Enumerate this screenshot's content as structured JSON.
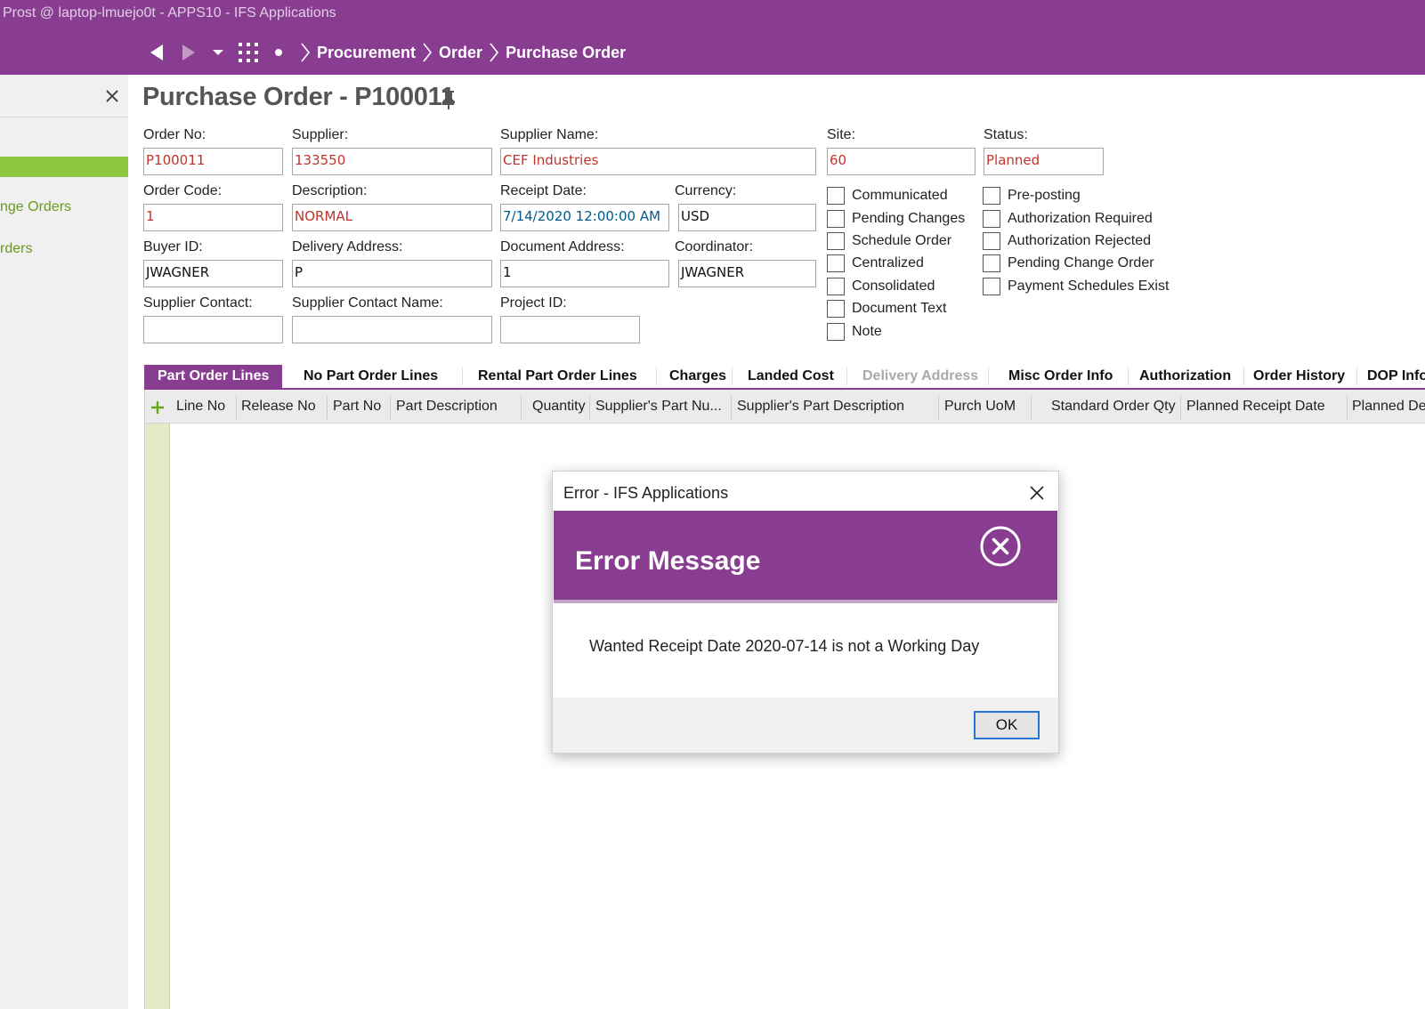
{
  "window": {
    "title": "Prost @ laptop-lmuejo0t - APPS10 - IFS Applications"
  },
  "breadcrumb": [
    "Procurement",
    "Order",
    "Purchase Order"
  ],
  "sidebar": {
    "links": [
      "nge Orders",
      "rders"
    ]
  },
  "page": {
    "title": "Purchase Order - P100011"
  },
  "form": {
    "order_no": {
      "label": "Order No:",
      "value": "P100011"
    },
    "supplier": {
      "label": "Supplier:",
      "value": "133550"
    },
    "supplier_name": {
      "label": "Supplier Name:",
      "value": "CEF Industries"
    },
    "site": {
      "label": "Site:",
      "value": "60"
    },
    "status": {
      "label": "Status:",
      "value": "Planned"
    },
    "order_code": {
      "label": "Order Code:",
      "value": "1"
    },
    "description": {
      "label": "Description:",
      "value": "NORMAL"
    },
    "receipt_date": {
      "label": "Receipt Date:",
      "value": "7/14/2020 12:00:00 AM"
    },
    "currency": {
      "label": "Currency:",
      "value": "USD"
    },
    "buyer_id": {
      "label": "Buyer ID:",
      "value": "JWAGNER"
    },
    "delivery_address": {
      "label": "Delivery Address:",
      "value": "P"
    },
    "document_address": {
      "label": "Document Address:",
      "value": "1"
    },
    "coordinator": {
      "label": "Coordinator:",
      "value": "JWAGNER"
    },
    "supplier_contact": {
      "label": "Supplier Contact:",
      "value": ""
    },
    "supplier_contact_name": {
      "label": "Supplier Contact Name:",
      "value": ""
    },
    "project_id": {
      "label": "Project ID:",
      "value": ""
    }
  },
  "checkboxes_left": [
    {
      "label": "Communicated",
      "checked": false
    },
    {
      "label": "Pending Changes",
      "checked": false
    },
    {
      "label": "Schedule Order",
      "checked": false
    },
    {
      "label": "Centralized",
      "checked": false
    },
    {
      "label": "Consolidated",
      "checked": false
    },
    {
      "label": "Document Text",
      "checked": false
    },
    {
      "label": "Note",
      "checked": false
    }
  ],
  "checkboxes_right": [
    {
      "label": "Pre-posting",
      "checked": false
    },
    {
      "label": "Authorization Required",
      "checked": false
    },
    {
      "label": "Authorization Rejected",
      "checked": false
    },
    {
      "label": "Pending Change Order",
      "checked": false
    },
    {
      "label": "Payment Schedules Exist",
      "checked": false
    }
  ],
  "tabs": [
    {
      "label": "Part Order Lines",
      "state": "active"
    },
    {
      "label": "No Part Order Lines",
      "state": "normal"
    },
    {
      "label": "Rental Part Order Lines",
      "state": "normal"
    },
    {
      "label": "Charges",
      "state": "normal"
    },
    {
      "label": "Landed Cost",
      "state": "normal"
    },
    {
      "label": "Delivery Address",
      "state": "disabled"
    },
    {
      "label": "Misc Order Info",
      "state": "normal"
    },
    {
      "label": "Authorization",
      "state": "normal"
    },
    {
      "label": "Order History",
      "state": "normal"
    },
    {
      "label": "DOP Info",
      "state": "normal"
    }
  ],
  "grid": {
    "columns": [
      "Line No",
      "Release No",
      "Part No",
      "Part Description",
      "Quantity",
      "Supplier's Part Nu...",
      "Supplier's Part Description",
      "Purch UoM",
      "Standard Order Qty",
      "Planned Receipt Date",
      "Planned Delivery Date"
    ]
  },
  "dialog": {
    "title": "Error - IFS Applications",
    "heading": "Error Message",
    "message": "Wanted Receipt Date 2020-07-14 is not a Working Day",
    "ok_label": "OK"
  },
  "colors": {
    "brand": "#883d90",
    "accent_green": "#8dc63f",
    "value_red": "#c2332b",
    "value_blue": "#005a8c",
    "ok_border": "#2676d0"
  },
  "icons": [
    "back-arrow-icon",
    "forward-arrow-icon",
    "dropdown-caret-icon",
    "app-grid-icon",
    "bullet-icon",
    "chevron-right-icon",
    "close-icon",
    "pin-icon",
    "add-icon",
    "error-circle-x-icon"
  ]
}
